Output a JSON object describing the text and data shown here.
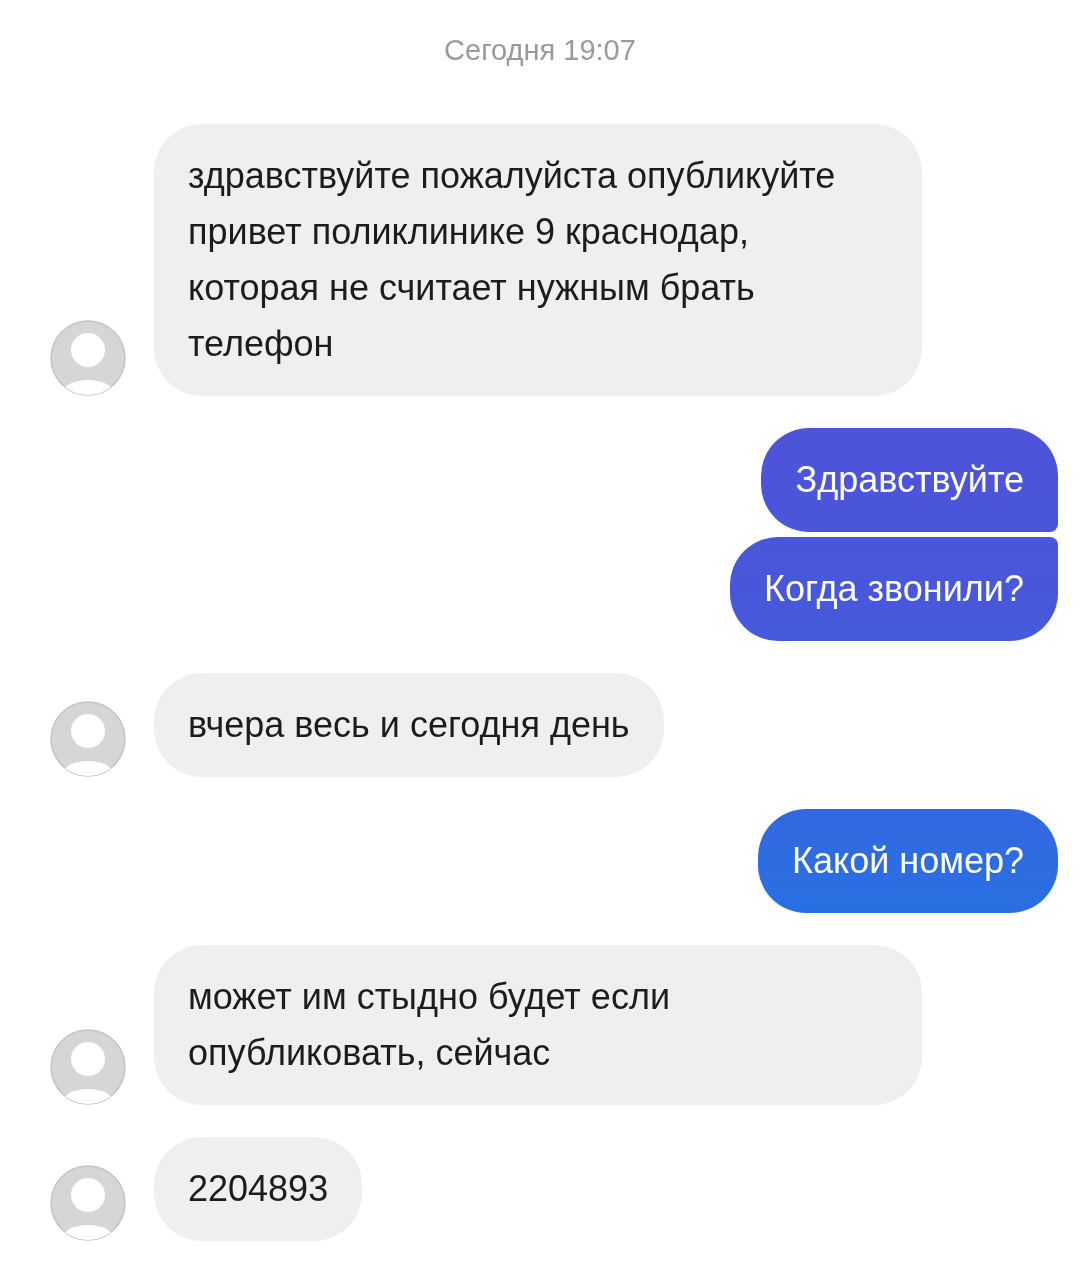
{
  "timestamp": "Сегодня 19:07",
  "messages": [
    {
      "kind": "incoming",
      "text": "здравствуйте пожалуйста опубликуйте привет поликлинике 9 краснодар, которая не считает нужным брать телефон"
    },
    {
      "kind": "outgoing",
      "text": "Здравствуйте"
    },
    {
      "kind": "outgoing",
      "text": "Когда звонили?"
    },
    {
      "kind": "incoming",
      "text": "вчера весь и сегодня день"
    },
    {
      "kind": "outgoing",
      "text": "Какой номер?"
    },
    {
      "kind": "incoming",
      "text": "может им стыдно будет если опубликовать, сейчас"
    },
    {
      "kind": "incoming",
      "text": "2204893"
    }
  ]
}
